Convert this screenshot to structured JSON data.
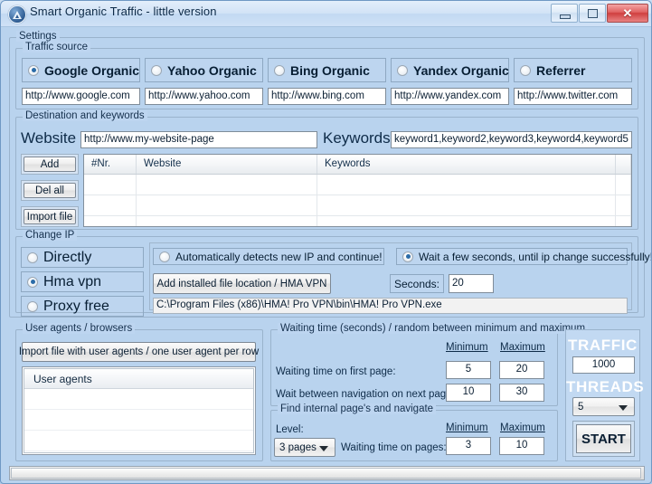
{
  "window": {
    "title": "Smart Organic Traffic - little version",
    "icon": "app-logo-icon",
    "minimize": "minimize-icon",
    "maximize": "maximize-icon",
    "close": "✕"
  },
  "settings": {
    "legend": "Settings"
  },
  "traffic_source": {
    "legend": "Traffic source",
    "options": [
      {
        "label": "Google Organic",
        "selected": true,
        "url": "http://www.google.com"
      },
      {
        "label": "Yahoo Organic",
        "selected": false,
        "url": "http://www.yahoo.com"
      },
      {
        "label": "Bing Organic",
        "selected": false,
        "url": "http://www.bing.com"
      },
      {
        "label": "Yandex Organic",
        "selected": false,
        "url": "http://www.yandex.com"
      },
      {
        "label": "Referrer",
        "selected": false,
        "url": "http://www.twitter.com"
      }
    ]
  },
  "destination": {
    "legend": "Destination and keywords",
    "website_label": "Website",
    "website_value": "http://www.my-website-page",
    "keywords_label": "Keywords",
    "keywords_value": "keyword1,keyword2,keyword3,keyword4,keyword5",
    "buttons": {
      "add": "Add",
      "del_all": "Del all",
      "import_file": "Import file"
    },
    "grid": {
      "columns": [
        "#Nr.",
        "Website",
        "Keywords"
      ],
      "rows": [
        {
          "nr": "",
          "website": "",
          "keywords": ""
        },
        {
          "nr": "",
          "website": "",
          "keywords": ""
        },
        {
          "nr": "",
          "website": "",
          "keywords": ""
        }
      ]
    }
  },
  "change_ip": {
    "legend": "Change IP",
    "modes": [
      {
        "label": "Directly",
        "selected": false
      },
      {
        "label": "Hma vpn",
        "selected": true
      },
      {
        "label": "Proxy free",
        "selected": false
      }
    ],
    "auto_detect": {
      "label": "Automatically detects new IP and continue!",
      "selected": false
    },
    "wait_seconds": {
      "label": "Wait a few seconds, until ip change successfully!",
      "selected": true
    },
    "add_location_button": "Add installed file location / HMA VPN",
    "seconds_label": "Seconds:",
    "seconds_value": "20",
    "path_value": "C:\\Program Files (x86)\\HMA! Pro VPN\\bin\\HMA! Pro VPN.exe"
  },
  "user_agents": {
    "legend": "User agents / browsers",
    "import_button": "Import file with user agents / one user agent per row",
    "list_header": "User agents",
    "rows": [
      "",
      "",
      "",
      "",
      ""
    ]
  },
  "waiting_time": {
    "legend": "Waiting time (seconds) / random between minimum and maximum",
    "minimum_header": "Minimum",
    "maximum_header": "Maximum",
    "rows": [
      {
        "label": "Waiting time on first page:",
        "min": "5",
        "max": "20"
      },
      {
        "label": "Wait between navigation on next page:",
        "min": "10",
        "max": "30"
      }
    ]
  },
  "internal_pages": {
    "legend": "Find internal page's and navigate",
    "level_label": "Level:",
    "level_value": "3 pages",
    "waiting_label": "Waiting time on pages:",
    "minimum_header": "Minimum",
    "maximum_header": "Maximum",
    "min": "3",
    "max": "10"
  },
  "run_panel": {
    "traffic_label": "TRAFFIC",
    "traffic_value": "1000",
    "threads_label": "THREADS",
    "threads_value": "5",
    "start_button": "START"
  }
}
